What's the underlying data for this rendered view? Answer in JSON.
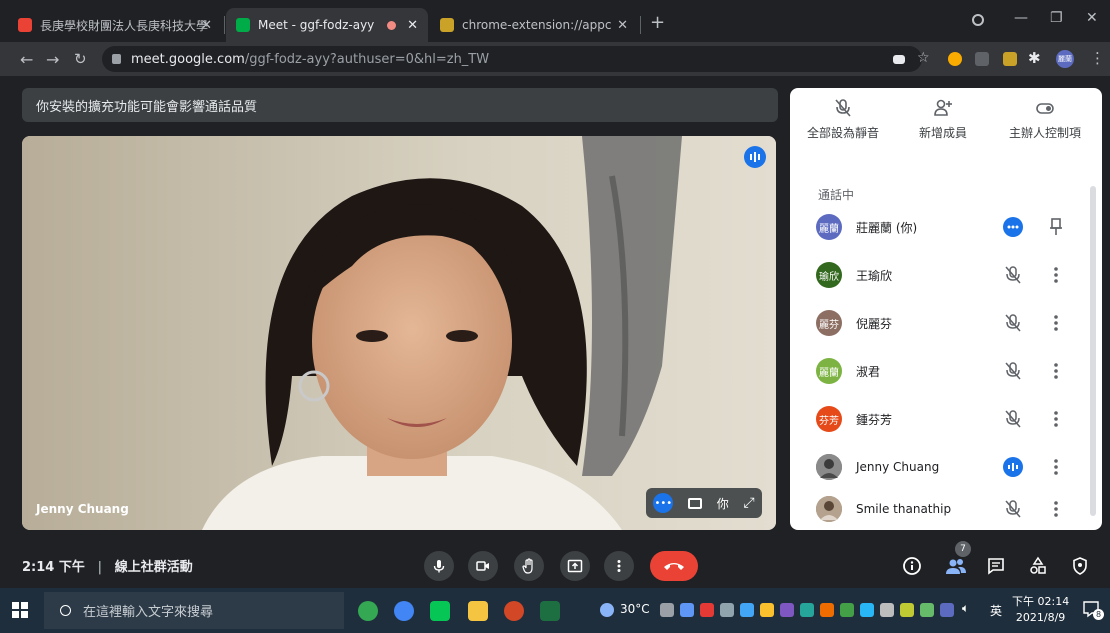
{
  "browser": {
    "tabs": [
      {
        "title": "長庚學校財團法人長庚科技大學 -",
        "favicon_color": "#ea4335"
      },
      {
        "title": "Meet - ggf-fodz-ayy",
        "favicon_color": "#00ac47"
      },
      {
        "title": "chrome-extension://appcnhiefl",
        "favicon_color": "#c9a227"
      }
    ],
    "new_tab_label": "+",
    "close_glyph": "✕",
    "url_host": "meet.google.com",
    "url_path": "/ggf-fodz-ayy?authuser=0&hl=zh_TW",
    "profile_initials": "麗蘭"
  },
  "meet": {
    "banner_text": "你安裝的擴充功能可能會影響通話品質",
    "main_video_name": "Jenny Chuang",
    "video_self_label": "你",
    "panel": {
      "actions": [
        {
          "label": "全部設為靜音",
          "icon": "mic-off-icon"
        },
        {
          "label": "新增成員",
          "icon": "person-add-icon"
        },
        {
          "label": "主辦人控制項",
          "icon": "toggle-icon"
        }
      ],
      "section_title": "通話中",
      "participants": [
        {
          "name": "莊麗蘭 (你)",
          "avatar": "麗蘭",
          "color": "#5c6bc0",
          "status": "more",
          "action": "pin"
        },
        {
          "name": "王瑜欣",
          "avatar": "瑜欣",
          "color": "#33691e",
          "status": "muted",
          "action": "more"
        },
        {
          "name": "倪麗芬",
          "avatar": "麗芬",
          "color": "#8d6e63",
          "status": "muted",
          "action": "more"
        },
        {
          "name": "淑君",
          "avatar": "麗蘭",
          "color": "#7cb342",
          "status": "muted",
          "action": "more"
        },
        {
          "name": "鍾芬芳",
          "avatar": "芬芳",
          "color": "#e64a19",
          "status": "muted",
          "action": "more"
        },
        {
          "name": "Jenny Chuang",
          "avatar": "",
          "color": "#6d6d6d",
          "status": "speaking",
          "action": "more"
        },
        {
          "name": "Smile thanathip",
          "avatar": "",
          "color": "#8a7a6a",
          "status": "muted",
          "action": "more"
        }
      ]
    },
    "bottom": {
      "time": "2:14 下午",
      "separator": "|",
      "meeting_title": "線上社群活動",
      "people_count": "7"
    }
  },
  "taskbar": {
    "search_placeholder": "在這裡輸入文字來搜尋",
    "weather": "30°C",
    "ime": "英",
    "time": "下午 02:14",
    "date": "2021/8/9",
    "notification_count": "8"
  }
}
